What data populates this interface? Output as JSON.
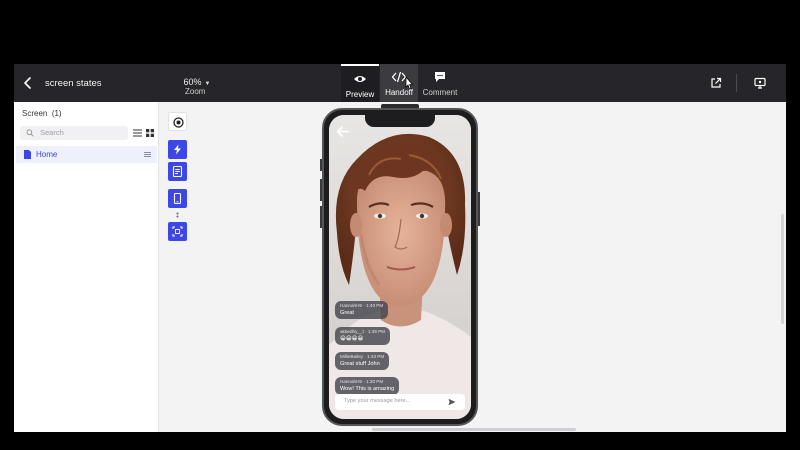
{
  "topbar": {
    "title": "screen states",
    "zoom_value": "60%",
    "zoom_label": "Zoom",
    "tabs": [
      {
        "label": "Preview",
        "icon": "eye-icon"
      },
      {
        "label": "Handoff",
        "icon": "code-icon"
      },
      {
        "label": "Comment",
        "icon": "comment-icon"
      }
    ]
  },
  "tooltip": "Handoff",
  "sidebar": {
    "title": "Screen",
    "count": "(1)",
    "search_placeholder": "Search",
    "screens": [
      {
        "label": "Home"
      }
    ]
  },
  "phone": {
    "messages": [
      {
        "user": "HannahH9",
        "time": "1:40 PM",
        "text": "Great"
      },
      {
        "user": "akbedhy__t",
        "time": "1:39 PM",
        "text": "😁😁😁😁"
      },
      {
        "user": "MillieBailey",
        "time": "1:33 PM",
        "text": "Great stuff John"
      },
      {
        "user": "HannahH9",
        "time": "1:30 PM",
        "text": "Wow! This is amazing"
      }
    ],
    "input_placeholder": "Type your message here..."
  },
  "colors": {
    "accent": "#3d47e6",
    "topbar_bg": "#26262a",
    "canvas_bg": "#f3f3f4"
  }
}
